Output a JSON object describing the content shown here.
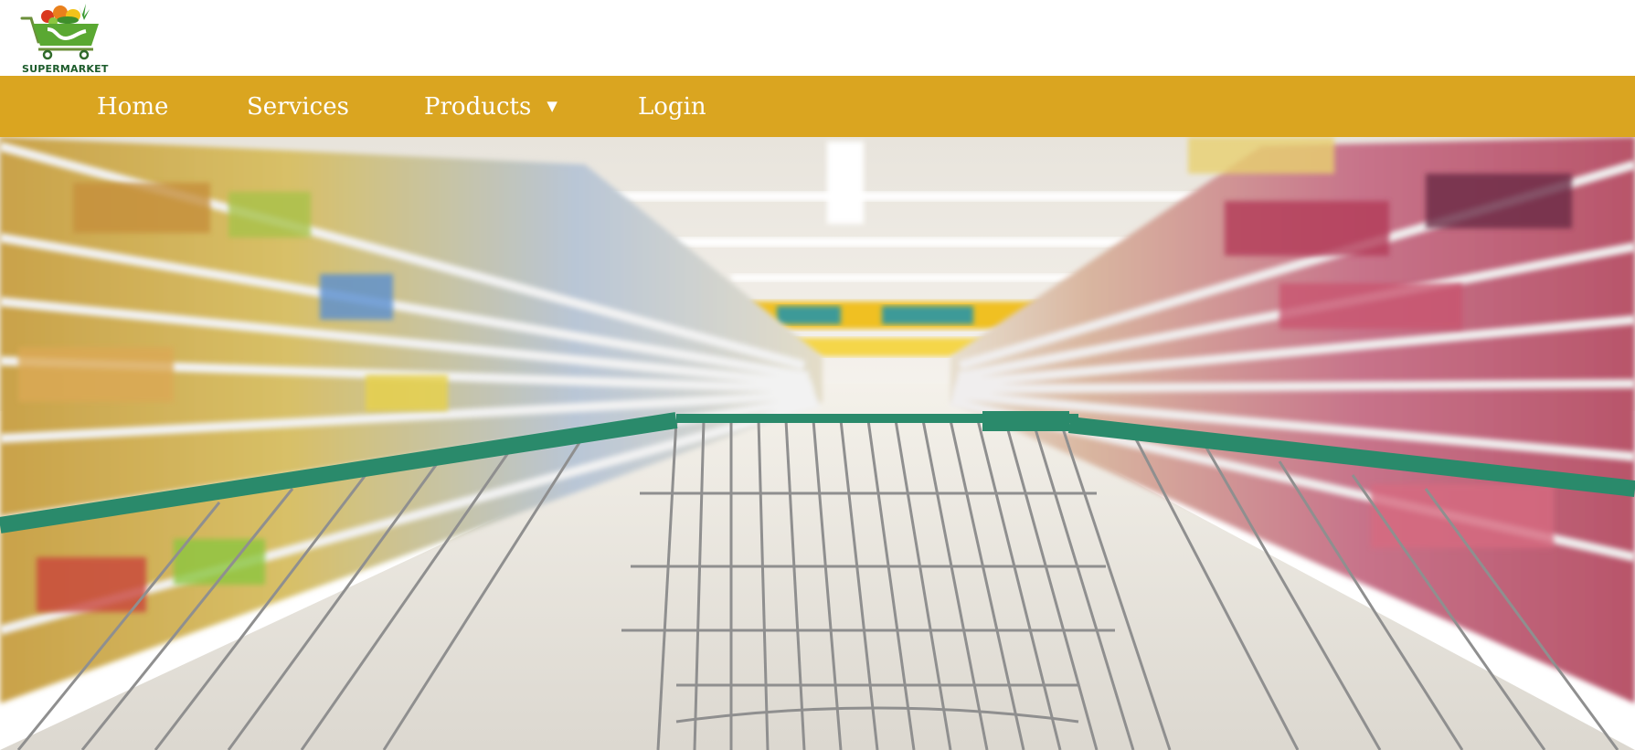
{
  "brand": {
    "logo_icon": "shopping-cart-with-produce",
    "logo_text": "SUPERMARKET"
  },
  "nav": {
    "items": [
      {
        "label": "Home"
      },
      {
        "label": "Services"
      },
      {
        "label": "Products",
        "has_dropdown": true,
        "dropdown_icon": "triangle-down"
      },
      {
        "label": "Login"
      }
    ]
  },
  "hero": {
    "image": "supermarket-aisle-with-shopping-cart"
  },
  "colors": {
    "nav_background": "#daa520",
    "nav_text": "#ffffff",
    "logo_green": "#1d5c2c",
    "cart_handle": "#2a8a6b"
  }
}
